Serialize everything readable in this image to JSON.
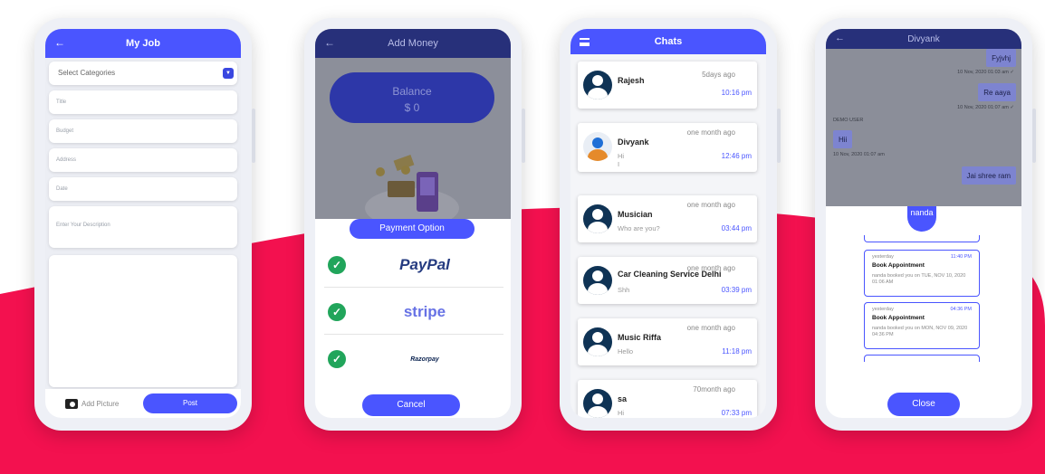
{
  "colors": {
    "accent": "#4a55ff",
    "wave": "#f3114f"
  },
  "phone1": {
    "title": "My Job",
    "back_icon": "arrow-left-icon",
    "category": "Select Categories",
    "fields": [
      "Title",
      "Budget",
      "Address",
      "Date",
      "Enter Your Description"
    ],
    "add_picture": "Add Picture",
    "post": "Post"
  },
  "phone2": {
    "title": "Add Money",
    "balance_label": "Balance",
    "balance_value": "$ 0",
    "payment_option": "Payment Option",
    "methods": [
      {
        "name": "PayPal",
        "checked": true
      },
      {
        "name": "stripe",
        "checked": true
      },
      {
        "name": "Razorpay",
        "checked": true
      }
    ],
    "cancel": "Cancel"
  },
  "phone3": {
    "title": "Chats",
    "chats": [
      {
        "name": "Rajesh",
        "message": "",
        "date": "5days ago",
        "time": "10:16 pm"
      },
      {
        "name": "Divyank",
        "message": "Hi\nI",
        "date": "one month ago",
        "time": "12:46 pm"
      },
      {
        "name": "Musician",
        "message": "Who are you?",
        "date": "one month ago",
        "time": "03:44 pm"
      },
      {
        "name": "Car Cleaning Service Delhi",
        "message": "Shh",
        "date": "one month ago",
        "time": "03:39 pm"
      },
      {
        "name": "Music Riffa",
        "message": "Hello",
        "date": "one month ago",
        "time": "11:18 pm"
      },
      {
        "name": "sa",
        "message": "Hi",
        "date": "70month ago",
        "time": "07:33 pm"
      }
    ]
  },
  "phone4": {
    "title": "Divyank",
    "messages": [
      {
        "text": "Fyjvhj",
        "meta": "10 Nov, 2020 01:03 am ✓"
      },
      {
        "text": "Re aaya",
        "meta": "10 Nov, 2020 01:07 am ✓"
      },
      {
        "sender": "DEMO USER",
        "text": "Hii",
        "meta": "10 Nov, 2020 01:07 am"
      },
      {
        "text": "Jai shree ram",
        "meta": ""
      }
    ],
    "sheet_user": "nanda",
    "appointments": [
      {
        "when": "yesterday",
        "time": "11:40 PM",
        "title": "Book Appointment",
        "desc": "nanda booked you on TUE, NOV 10, 2020 01:06 AM"
      },
      {
        "when": "yesterday",
        "time": "04:36 PM",
        "title": "Book Appointment",
        "desc": "nanda booked you on MON, NOV 09, 2020 04:36 PM"
      }
    ],
    "close": "Close"
  }
}
